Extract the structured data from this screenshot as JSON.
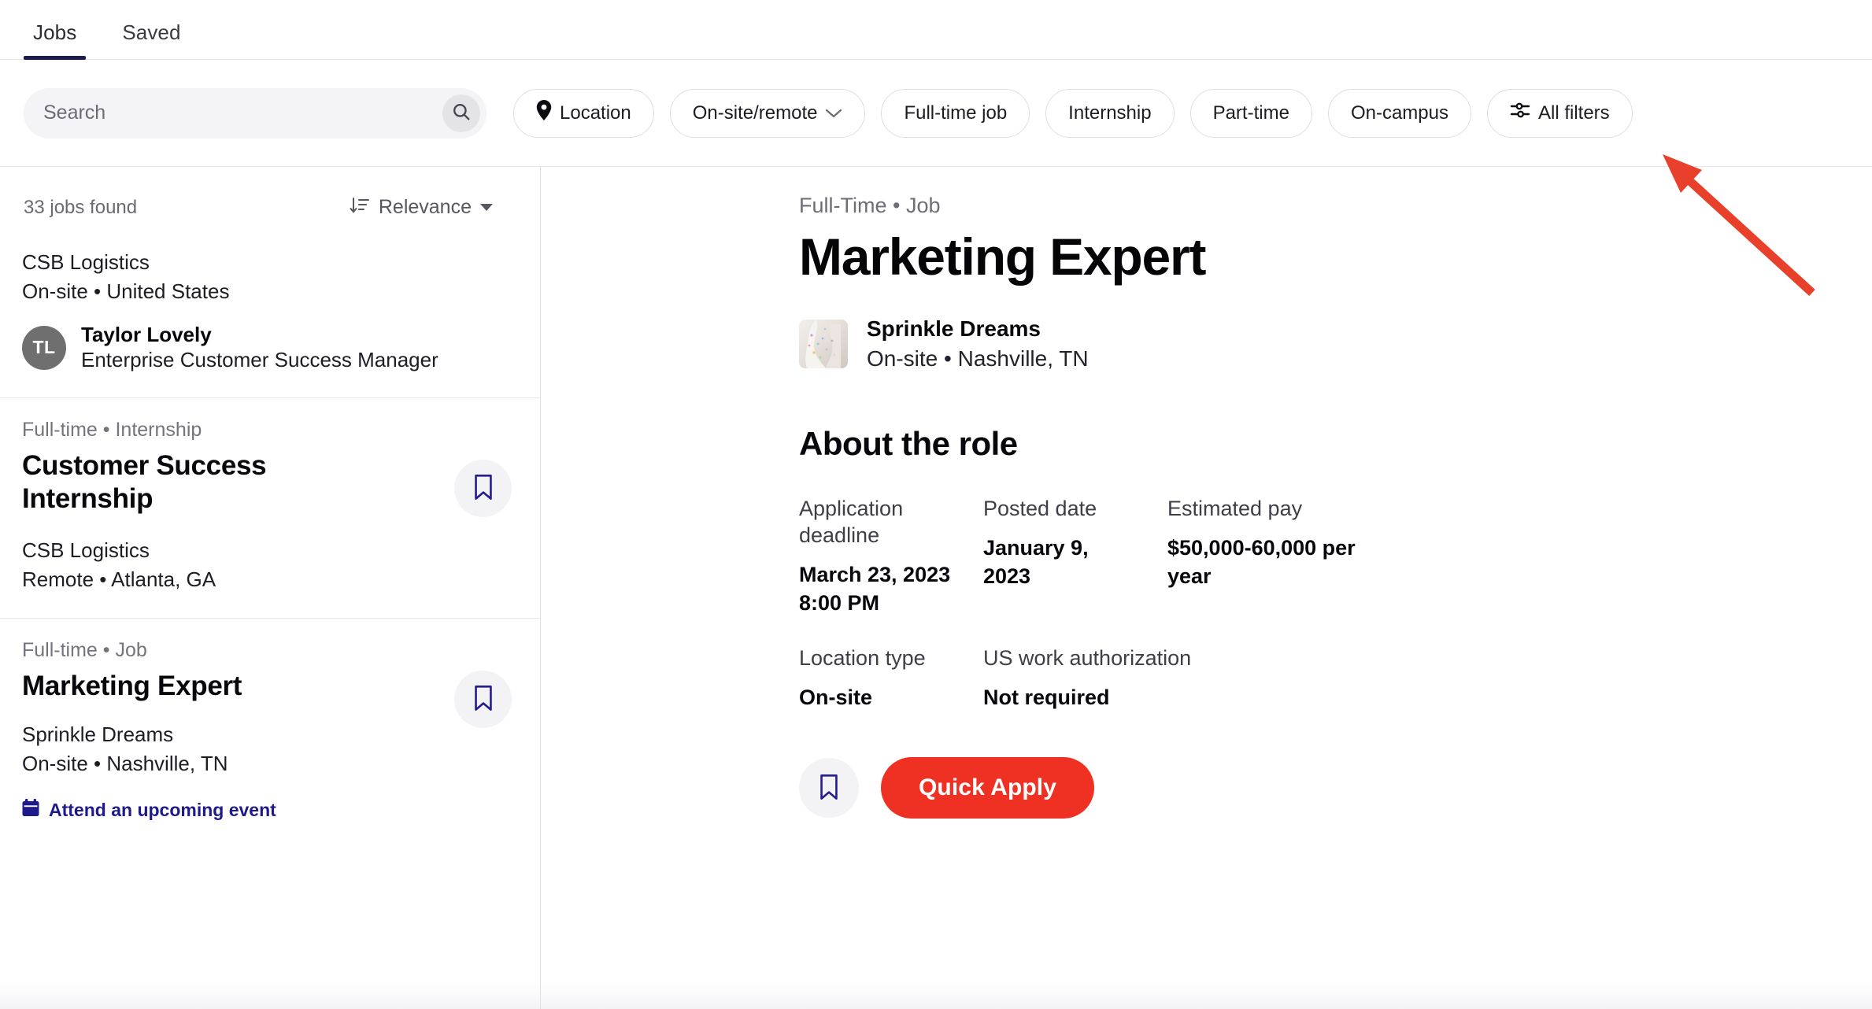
{
  "tabs": [
    {
      "label": "Jobs",
      "active": true
    },
    {
      "label": "Saved",
      "active": false
    }
  ],
  "search": {
    "value": "",
    "placeholder": "Search",
    "icon": "search-icon"
  },
  "filters": [
    {
      "label": "Location",
      "icon": "location-pin-icon",
      "chevron": false
    },
    {
      "label": "On-site/remote",
      "icon": null,
      "chevron": true
    },
    {
      "label": "Full-time job",
      "icon": null,
      "chevron": false
    },
    {
      "label": "Internship",
      "icon": null,
      "chevron": false
    },
    {
      "label": "Part-time",
      "icon": null,
      "chevron": false
    },
    {
      "label": "On-campus",
      "icon": null,
      "chevron": false
    },
    {
      "label": "All filters",
      "icon": "sliders-icon",
      "chevron": false
    }
  ],
  "sidebar": {
    "results_count": "33 jobs found",
    "sort": {
      "label": "Relevance",
      "icon": "sort-descending-icon"
    },
    "cards": [
      {
        "type": "contact",
        "company": "CSB Logistics",
        "location": "On-site • United States",
        "person": {
          "initials": "TL",
          "name": "Taylor Lovely",
          "role": "Enterprise Customer Success Manager"
        }
      },
      {
        "type": "job",
        "meta": "Full-time • Internship",
        "title": "Customer Success Internship",
        "company": "CSB Logistics",
        "location": "Remote • Atlanta, GA",
        "bookmarked": false
      },
      {
        "type": "job",
        "meta": "Full-time • Job",
        "title": "Marketing Expert",
        "company": "Sprinkle Dreams",
        "location": "On-site • Nashville, TN",
        "bookmarked": false,
        "event_link": "Attend an upcoming event"
      }
    ]
  },
  "detail": {
    "kicker": "Full-Time • Job",
    "title": "Marketing Expert",
    "company_name": "Sprinkle Dreams",
    "company_location": "On-site • Nashville, TN",
    "section_title": "About the role",
    "facts": [
      {
        "label": "Application deadline",
        "value": "March 23, 2023 8:00 PM"
      },
      {
        "label": "Posted date",
        "value": "January 9, 2023"
      },
      {
        "label": "Estimated pay",
        "value": "$50,000-60,000 per year"
      },
      {
        "label": "Location type",
        "value": "On-site"
      },
      {
        "label": "US work authorization",
        "value": "Not required"
      }
    ],
    "save_icon": "bookmark-icon",
    "apply_label": "Quick Apply"
  },
  "colors": {
    "accent_red": "#ef3124",
    "navy": "#1f1a8c",
    "tab_underline": "#1c1b4b",
    "annotation_arrow": "#e8402a",
    "avatar_bg": "#6f6f6f",
    "chip_border": "#dededf",
    "search_bg": "#f4f4f6"
  },
  "annotation": {
    "type": "arrow",
    "points_to": "All filters",
    "color": "#e8402a"
  }
}
